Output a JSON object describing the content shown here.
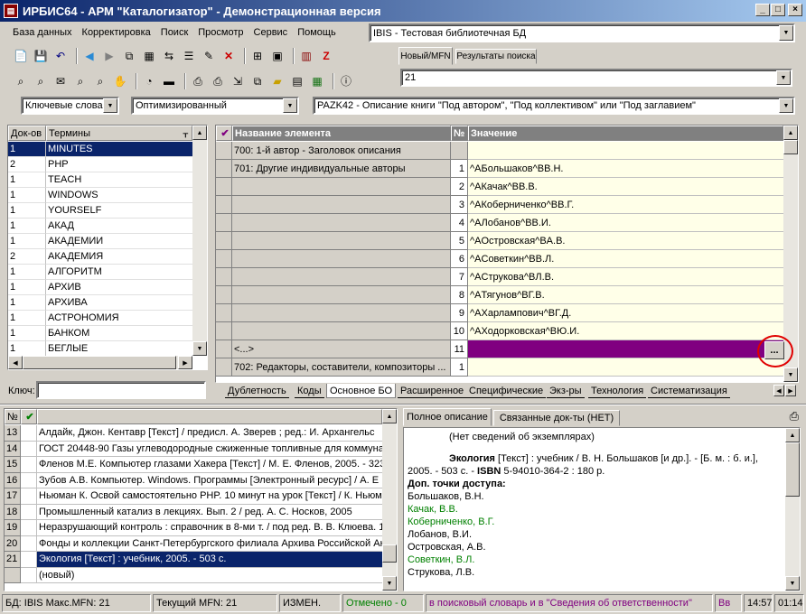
{
  "window": {
    "title": "ИРБИС64 - АРМ \"Каталогизатор\" - Демонстрационная версия",
    "icon": "book-icon"
  },
  "menu": [
    "База данных",
    "Корректировка",
    "Поиск",
    "Просмотр",
    "Сервис",
    "Помощь"
  ],
  "database": {
    "selected": "IBIS - Тестовая библиотечная БД"
  },
  "search_tabs": [
    "Новый/MFN",
    "Результаты поиска"
  ],
  "mfn_value": "21",
  "dictionary": {
    "type": "Ключевые слова",
    "mode": "Оптимизированный",
    "key_label": "Ключ:",
    "key_value": "",
    "headers": {
      "docs": "Док-ов",
      "terms": "Термины"
    },
    "rows": [
      {
        "n": "1",
        "t": "MINUTES"
      },
      {
        "n": "2",
        "t": "PHP"
      },
      {
        "n": "1",
        "t": "TEACH"
      },
      {
        "n": "1",
        "t": "WINDOWS"
      },
      {
        "n": "1",
        "t": "YOURSELF"
      },
      {
        "n": "1",
        "t": "АКАД"
      },
      {
        "n": "1",
        "t": "АКАДЕМИИ"
      },
      {
        "n": "2",
        "t": "АКАДЕМИЯ"
      },
      {
        "n": "1",
        "t": "АЛГОРИТМ"
      },
      {
        "n": "1",
        "t": "АРХИВ"
      },
      {
        "n": "1",
        "t": "АРХИВА"
      },
      {
        "n": "1",
        "t": "АСТРОНОМИЯ"
      },
      {
        "n": "1",
        "t": "БАНКОМ"
      },
      {
        "n": "1",
        "t": "БЕГЛЫЕ"
      }
    ]
  },
  "worksheet": {
    "selected": "PAZK42 - Описание книги \"Под автором\", \"Под коллективом\" или \"Под заглавием\"",
    "headers": {
      "name": "Название элемента",
      "num": "№",
      "value": "Значение"
    },
    "rows": [
      {
        "name": "700: 1-й автор - Заголовок описания",
        "num": "",
        "value": ""
      },
      {
        "name": "701: Другие индивидуальные авторы",
        "num": "1",
        "value": "^AБольшаков^BВ.Н."
      },
      {
        "name": "",
        "num": "2",
        "value": "^AКачак^BВ.В."
      },
      {
        "name": "",
        "num": "3",
        "value": "^AКоберниченко^BВ.Г."
      },
      {
        "name": "",
        "num": "4",
        "value": "^AЛобанов^BВ.И."
      },
      {
        "name": "",
        "num": "5",
        "value": "^AОстровская^BА.В."
      },
      {
        "name": "",
        "num": "6",
        "value": "^AСоветкин^BВ.Л."
      },
      {
        "name": "",
        "num": "7",
        "value": "^AСтрукова^BЛ.В."
      },
      {
        "name": "",
        "num": "8",
        "value": "^AТягунов^BГ.В."
      },
      {
        "name": "",
        "num": "9",
        "value": "^AХарлампович^BГ.Д."
      },
      {
        "name": "",
        "num": "10",
        "value": "^AХодорковская^BЮ.И."
      },
      {
        "name": "<...>",
        "num": "11",
        "value": ""
      },
      {
        "name": "702: Редакторы, составители, композиторы ...",
        "num": "1",
        "value": ""
      }
    ],
    "more_button": "...",
    "tabs": [
      "Дублетность",
      "Коды",
      "Основное БО",
      "Расширенное",
      "Специфические",
      "Экз-ры",
      "Технология",
      "Систематизация"
    ]
  },
  "records": {
    "rows": [
      {
        "n": "13",
        "t": "Алдайк, Джон. Кентавр [Текст] / предисл. А. Зверев ; ред.: И. Архангельс"
      },
      {
        "n": "14",
        "t": "ГОСТ 20448-90 Газы углеводородные сжиженные топливные для коммуна"
      },
      {
        "n": "15",
        "t": "Фленов М.Е. Компьютер глазами Хакера [Текст] / М. Е. Фленов, 2005. - 323"
      },
      {
        "n": "16",
        "t": "Зубов А.В. Компьютер. Windows. Программы [Электронный ресурс] / А. Е"
      },
      {
        "n": "17",
        "t": "Ньюман К. Освой самостоятельно PHP. 10 минут на урок [Текст] / К. Ньюм"
      },
      {
        "n": "18",
        "t": "Промышленный катализ в лекциях. Вып. 2 / ред. А. С. Носков, 2005"
      },
      {
        "n": "19",
        "t": "Неразрушающий контроль : справочник в 8-ми т. / под ред. В. В. Клюева. 1"
      },
      {
        "n": "20",
        "t": "Фонды и коллекции Санкт-Петербургского филиала Архива Российской Ак"
      },
      {
        "n": "21",
        "t": "Экология [Текст] : учебник, 2005. - 503 с."
      },
      {
        "n": "",
        "t": "(новый)"
      }
    ],
    "header_n": "№"
  },
  "description": {
    "tabs": [
      "Полное описание",
      "Связанные док-ты (НЕТ)"
    ],
    "no_copies": "(Нет сведений об экземплярах)",
    "main_title": "Экология",
    "main_rest": " [Текст] : учебник / В. Н. Большаков [и др.]. - [Б. м. : б. и.], 2005. - 503 с. - ",
    "isbn_label": "ISBN",
    "isbn_rest": " 5-94010-364-2 : 180 р.",
    "access_label": "Доп. точки доступа:",
    "people": [
      {
        "t": "Большаков, В.Н.",
        "c": "#000000"
      },
      {
        "t": "Качак, В.В.",
        "c": "#008000"
      },
      {
        "t": "Коберниченко, В.Г.",
        "c": "#008000"
      },
      {
        "t": "Лобанов, В.И.",
        "c": "#000000"
      },
      {
        "t": "Островская, А.В.",
        "c": "#000000"
      },
      {
        "t": "Советкин, В.Л.",
        "c": "#008000"
      },
      {
        "t": "Струкова, Л.В.",
        "c": "#000000"
      }
    ]
  },
  "status": {
    "db": "БД: IBIS Макс.MFN: 21",
    "current": "Текущий MFN: 21",
    "changed": "ИЗМЕН.",
    "marked": "Отмечено - 0",
    "hint": "в поисковый словарь и в \"Сведения об ответственности\"",
    "mode": "Вв",
    "time": "14:57",
    "elapsed": "01:14"
  },
  "colors": {
    "selection": "#0a246a",
    "highlight_row": "#800080",
    "yellow": "#ffffe8",
    "red_circle": "#e00000"
  }
}
